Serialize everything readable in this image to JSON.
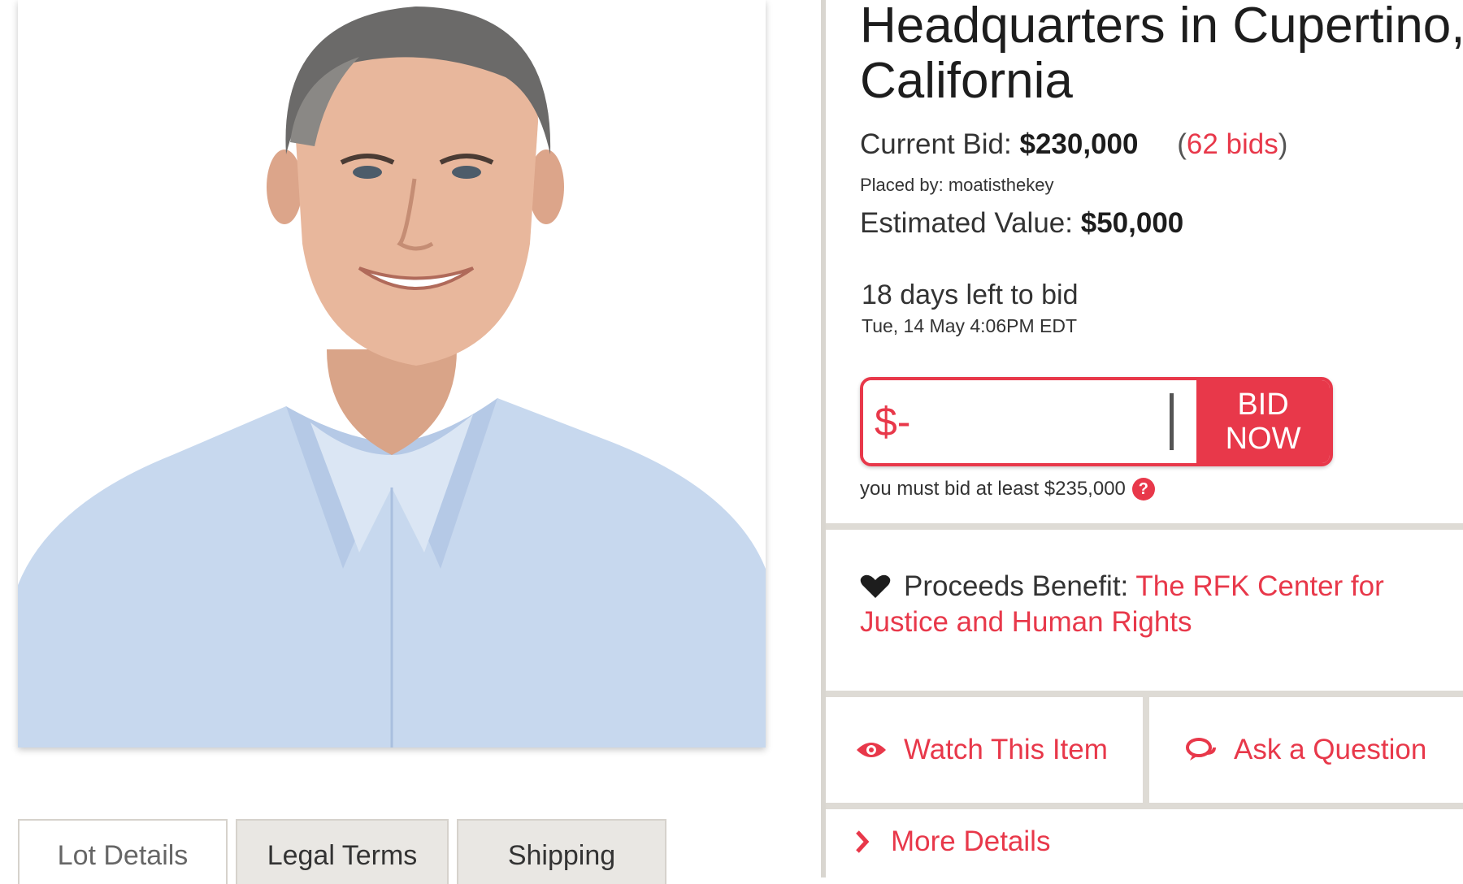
{
  "lot": {
    "title_line1": "Headquarters in Cupertino,",
    "title_line2": "California"
  },
  "bidding": {
    "current_bid_label": "Current Bid:",
    "current_bid_value": "$230,000",
    "bid_count": "62 bids",
    "placed_by": "Placed by: moatisthekey",
    "estimated_label": "Estimated Value:",
    "estimated_value": "$50,000",
    "time_left": "18 days left to bid",
    "end_time": "Tue, 14 May 4:06PM EDT",
    "input_value": "$-",
    "bid_button_line1": "BID",
    "bid_button_line2": "NOW",
    "min_bid_note": "you must bid at least $235,000",
    "help_glyph": "?"
  },
  "charity": {
    "label": "Proceeds Benefit:",
    "name": "The RFK Center for Justice and Human Rights"
  },
  "actions": {
    "watch": "Watch This Item",
    "ask": "Ask a Question",
    "more": "More Details"
  },
  "tabs": [
    "Lot Details",
    "Legal Terms",
    "Shipping"
  ],
  "icons": {
    "heart": "heart-icon",
    "watch": "eye-icon",
    "ask": "speech-bubbles-icon",
    "more": "chevron-right-icon"
  },
  "colors": {
    "accent": "#e8384a",
    "divider": "#dedbd5",
    "text": "#333333"
  }
}
